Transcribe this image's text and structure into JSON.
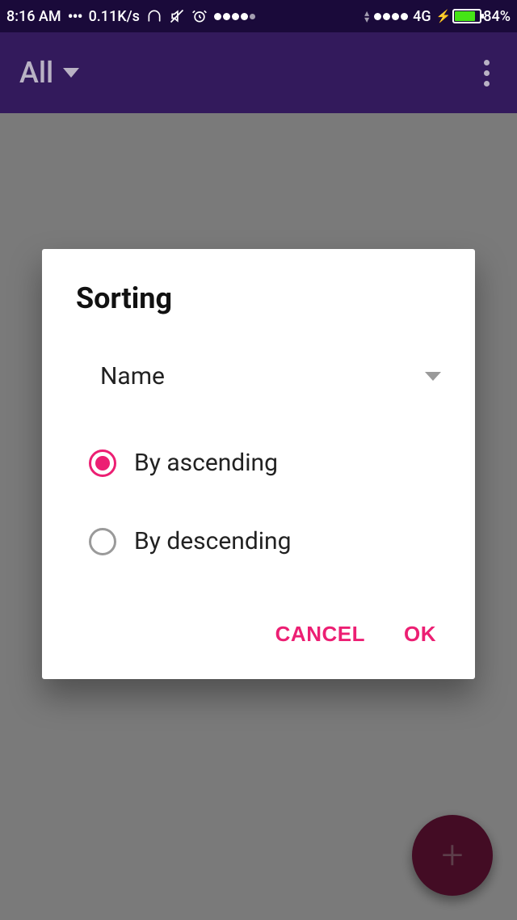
{
  "status": {
    "time": "8:16 AM",
    "speed": "0.11K/s",
    "network_label": "4G",
    "battery_pct": "84%"
  },
  "appbar": {
    "title": "All"
  },
  "dialog": {
    "title": "Sorting",
    "select": {
      "value": "Name"
    },
    "options": [
      {
        "label": "By ascending",
        "selected": true
      },
      {
        "label": "By descending",
        "selected": false
      }
    ],
    "actions": {
      "cancel": "CANCEL",
      "ok": "OK"
    }
  },
  "fab": {
    "glyph": "+"
  }
}
